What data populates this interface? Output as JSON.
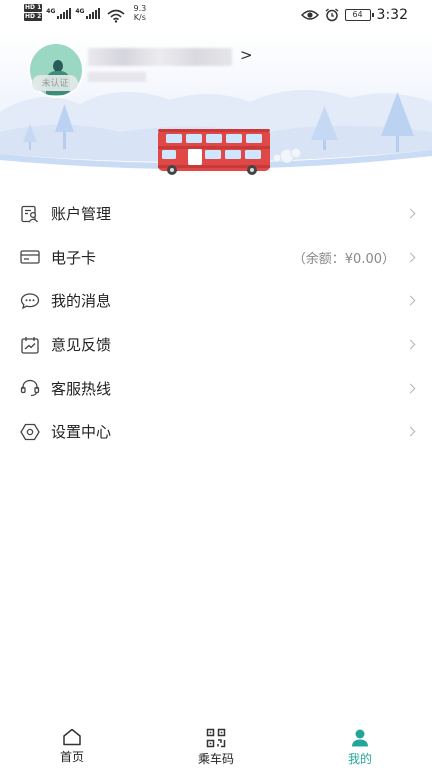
{
  "status_bar": {
    "hd1": "HD 1",
    "hd2": "HD 2",
    "net1": "4G",
    "net2": "4G",
    "speed_value": "9.3",
    "speed_unit": "K/s",
    "battery": "64",
    "time": "3:32"
  },
  "profile": {
    "verify_badge": "未认证",
    "arrow": ">"
  },
  "menu": {
    "items": [
      {
        "label": "账户管理",
        "icon": "account-manage-icon"
      },
      {
        "label": "电子卡",
        "extra": "（余额：¥0.00）",
        "icon": "card-icon"
      },
      {
        "label": "我的消息",
        "icon": "message-icon"
      },
      {
        "label": "意见反馈",
        "icon": "feedback-icon"
      },
      {
        "label": "客服热线",
        "icon": "headset-icon"
      },
      {
        "label": "设置中心",
        "icon": "settings-icon"
      }
    ]
  },
  "tabbar": {
    "tabs": [
      {
        "label": "首页",
        "icon": "home-icon"
      },
      {
        "label": "乘车码",
        "icon": "qr-code-icon"
      },
      {
        "label": "我的",
        "icon": "user-icon",
        "active": true
      }
    ]
  },
  "colors": {
    "accent": "#25a59a",
    "bus_red": "#e04848",
    "sky": "#e8f0fb"
  }
}
